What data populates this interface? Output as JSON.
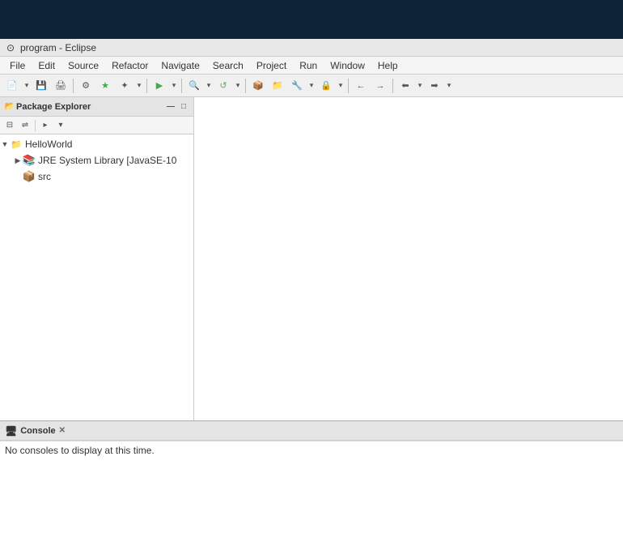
{
  "window": {
    "top_bar_color": "#0d2137",
    "title": "program - Eclipse",
    "title_icon": "⊙"
  },
  "menubar": {
    "items": [
      "File",
      "Edit",
      "Source",
      "Refactor",
      "Navigate",
      "Search",
      "Project",
      "Run",
      "Window",
      "Help"
    ]
  },
  "toolbar": {
    "groups": [
      [
        "new-btn",
        "save-btn",
        "print-btn"
      ],
      [
        "run-ext-btn"
      ],
      [
        "back-btn",
        "fwd-btn"
      ],
      [
        "search-btn",
        "ref-btn",
        "debug-btn"
      ],
      [
        "play-btn"
      ],
      [
        "run-btn"
      ],
      [
        "ext1-btn",
        "ext2-btn",
        "ext3-btn"
      ]
    ]
  },
  "package_explorer": {
    "title": "Package Explorer",
    "project": {
      "name": "HelloWorld",
      "children": [
        {
          "label": "JRE System Library [JavaSE-10",
          "type": "library"
        },
        {
          "label": "src",
          "type": "package"
        }
      ]
    }
  },
  "console": {
    "title": "Console",
    "message": "No consoles to display at this time."
  }
}
